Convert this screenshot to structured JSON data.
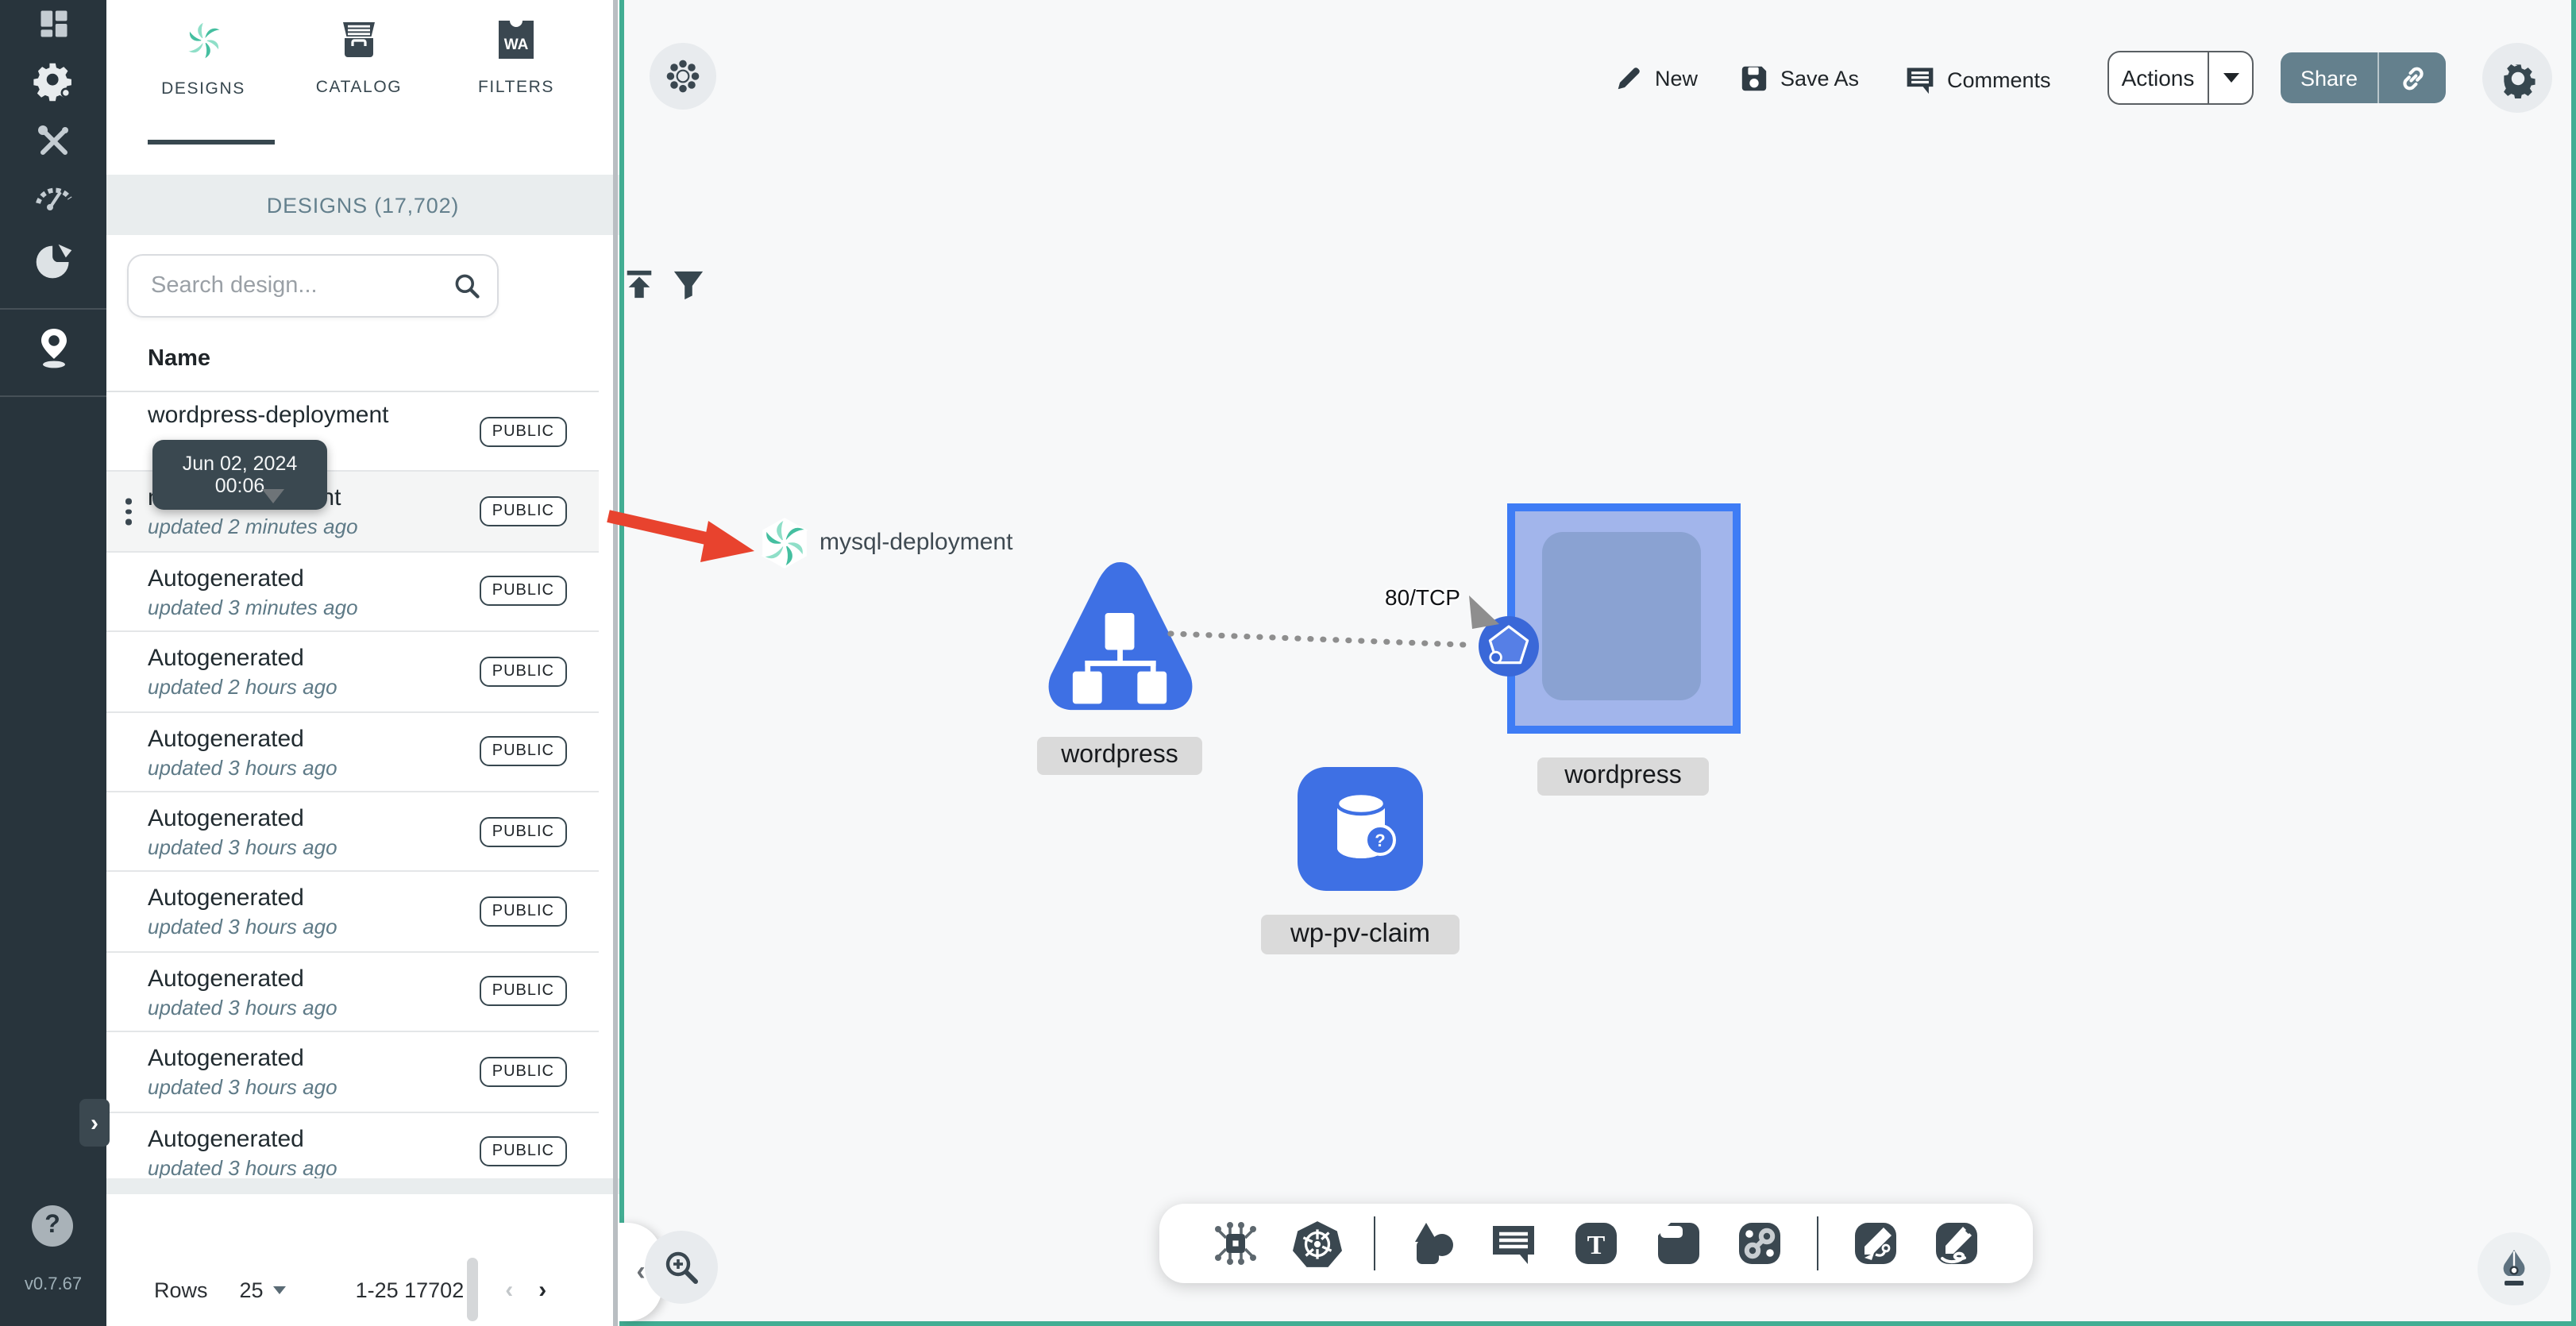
{
  "app": {
    "version": "v0.7.67",
    "help_label": "?"
  },
  "colors": {
    "accent_teal": "#42AD93",
    "rail_bg": "#28343C",
    "slate": "#3A4750",
    "node_blue": "#3E70E4",
    "square_border": "#3E7CF5",
    "square_fill": "#A2B5EB",
    "red_arrow": "#E8432E",
    "chip_gray": "#D7D7D7",
    "tooltip_bg": "#3A4850"
  },
  "rail": {
    "icons": [
      "dashboard-icon",
      "lifecycle-gears-icon",
      "configuration-tools-icon",
      "performance-speedometer-icon",
      "extensions-doughnut-icon",
      "kanvas-pin-icon"
    ],
    "expander": "›"
  },
  "panel": {
    "tabs": [
      {
        "label": "DESIGNS",
        "icon": "meshery-logo",
        "active": true
      },
      {
        "label": "CATALOG",
        "icon": "catalog-archive-icon",
        "active": false
      },
      {
        "label": "FILTERS",
        "icon": "wasm-filter-icon",
        "active": false
      }
    ],
    "filters_icon_text": "WA",
    "header": "DESIGNS (17,702)",
    "search": {
      "placeholder": "Search design...",
      "icons": [
        "search-icon",
        "upload-icon",
        "filter-funnel-icon"
      ]
    },
    "column_header": "Name",
    "tooltip": "Jun 02, 2024 00:06",
    "rows": [
      {
        "name": "wordpress-deployment",
        "updated": "",
        "badge": "PUBLIC",
        "hover": false,
        "kebab": false
      },
      {
        "name": "mysql-deployment",
        "updated": "updated 2 minutes ago",
        "badge": "PUBLIC",
        "hover": true,
        "kebab": true
      },
      {
        "name": "Autogenerated",
        "updated": "updated 3 minutes ago",
        "badge": "PUBLIC",
        "hover": false,
        "kebab": false
      },
      {
        "name": "Autogenerated",
        "updated": "updated 2 hours ago",
        "badge": "PUBLIC",
        "hover": false,
        "kebab": false
      },
      {
        "name": "Autogenerated",
        "updated": "updated 3 hours ago",
        "badge": "PUBLIC",
        "hover": false,
        "kebab": false
      },
      {
        "name": "Autogenerated",
        "updated": "updated 3 hours ago",
        "badge": "PUBLIC",
        "hover": false,
        "kebab": false
      },
      {
        "name": "Autogenerated",
        "updated": "updated 3 hours ago",
        "badge": "PUBLIC",
        "hover": false,
        "kebab": false
      },
      {
        "name": "Autogenerated",
        "updated": "updated 3 hours ago",
        "badge": "PUBLIC",
        "hover": false,
        "kebab": false
      },
      {
        "name": "Autogenerated",
        "updated": "updated 3 hours ago",
        "badge": "PUBLIC",
        "hover": false,
        "kebab": false
      },
      {
        "name": "Autogenerated",
        "updated": "updated 3 hours ago",
        "badge": "PUBLIC",
        "hover": false,
        "kebab": false
      }
    ],
    "pagination": {
      "rows_label": "Rows",
      "per_page": "25",
      "range": "1-25 17702",
      "prev": "‹",
      "next": "›"
    }
  },
  "header_actions": {
    "new_label": "New",
    "save_as_label": "Save As",
    "comments_label": "Comments",
    "actions_label": "Actions",
    "share_label": "Share"
  },
  "canvas": {
    "dragged_design": "mysql-deployment",
    "edge_label": "80/TCP",
    "nodes": [
      {
        "type": "deployment-triangle",
        "label": "wordpress"
      },
      {
        "type": "service-square",
        "label": "wordpress"
      },
      {
        "type": "pvc-squircle",
        "label": "wp-pv-claim"
      }
    ],
    "toolbar_icons": [
      "component-circuit-icon",
      "kubernetes-icon",
      "shapes-icon",
      "comment-icon",
      "text-icon",
      "note-icon",
      "link-icon",
      "pen-arrow-icon",
      "pencil-scribble-icon"
    ]
  }
}
